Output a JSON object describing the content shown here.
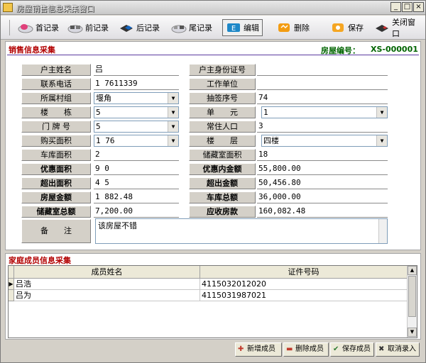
{
  "window": {
    "title": "房屋销售信息采集窗口",
    "controls": [
      "_",
      "□",
      "×"
    ]
  },
  "toolbar": {
    "first": "首记录",
    "prev": "前记录",
    "next": "后记录",
    "last": "尾记录",
    "edit": "编辑",
    "delete": "删除",
    "save": "保存",
    "close": "关闭窗口"
  },
  "sales_info": {
    "section_title": "销售信息采集",
    "house_no_label": "房屋编号：",
    "house_no": "XS-000001",
    "owner_name_label": "户主姓名",
    "owner_name": "吕",
    "owner_id_label": "户主身份证号",
    "owner_id": "",
    "phone_label": "联系电话",
    "phone": "1  7611339",
    "work_unit_label": "工作单位",
    "work_unit": "",
    "village_label": "所属村组",
    "village": "   堰角",
    "lottery_no_label": "抽签序号",
    "lottery_no": "74",
    "building_label": "楼　　栋",
    "building": "5",
    "unit_label": "单　　元",
    "unit": "1",
    "door_no_label": "门 牌 号",
    "door_no": "5",
    "residents_label": "常住人口",
    "residents": "3",
    "area_label": "购买面积",
    "area": "1  76",
    "floor_label": "楼　　层",
    "floor": "四楼",
    "garage_area_label": "车库面积",
    "garage_area": "2",
    "storage_area_label": "储藏室面积",
    "storage_area": "18",
    "discount_area_label": "优惠面积",
    "discount_area": "9   0",
    "discount_amount_label": "优惠内金额",
    "discount_amount": "55,800.00",
    "excess_area_label": "超出面积",
    "excess_area": "4   5",
    "excess_amount_label": "超出金额",
    "excess_amount": "50,456.80",
    "house_amount_label": "房屋金额",
    "house_amount": "1  882.48",
    "garage_total_label": "车库总额",
    "garage_total": "36,000.00",
    "storage_total_label": "储藏室总额",
    "storage_total": "7,200.00",
    "receivable_label": "应收房款",
    "receivable": "160,082.48",
    "remark_label": "备　　注",
    "remark": "该房屋不错"
  },
  "family": {
    "section_title": "家庭成员信息采集",
    "columns": [
      "成员姓名",
      "证件号码"
    ],
    "rows": [
      [
        "吕浩",
        "4115032012020"
      ],
      [
        "吕为",
        "4115031987021"
      ]
    ]
  },
  "bottom_buttons": {
    "add": "新增成员",
    "delete": "删除成员",
    "save": "保存成员",
    "cancel": "取消录入"
  }
}
